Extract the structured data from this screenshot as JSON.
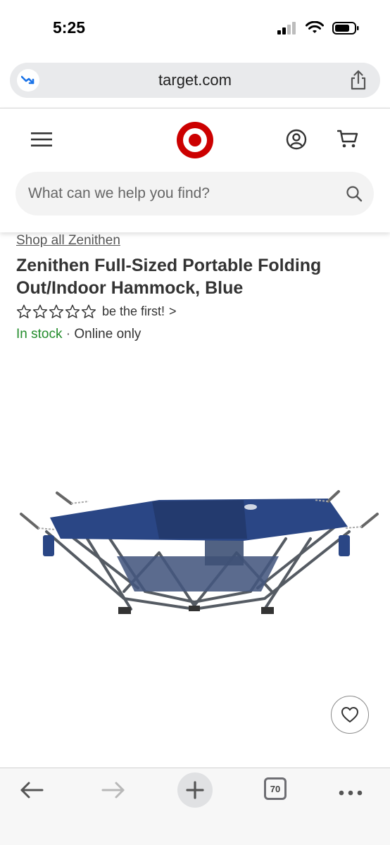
{
  "status_bar": {
    "time": "5:25",
    "icons": [
      "signal-icon",
      "wifi-icon",
      "battery-icon"
    ]
  },
  "browser": {
    "url": "target.com",
    "icons": [
      "tracking-icon",
      "share-icon"
    ]
  },
  "header": {
    "icons": [
      "menu-icon",
      "target-logo",
      "account-icon",
      "cart-icon"
    ],
    "brand_color": "#cc0000"
  },
  "search": {
    "placeholder": "What can we help you find?",
    "value": ""
  },
  "product": {
    "shop_all_link": "Shop all Zenithen",
    "title": "Zenithen Full-Sized Portable Folding Out/Indoor Hammock, Blue",
    "rating": {
      "stars_filled": 0,
      "stars_total": 5,
      "text": "be the first!",
      "chevron": ">"
    },
    "availability": {
      "status": "In stock",
      "separator": "·",
      "channel": "Online only",
      "status_color": "#238c2c"
    },
    "favorite_icon": "heart-icon"
  },
  "bottom_toolbar": {
    "tab_count": "70",
    "icons": [
      "back-arrow-icon",
      "forward-arrow-icon",
      "plus-icon",
      "tabs-icon",
      "more-icon"
    ]
  }
}
